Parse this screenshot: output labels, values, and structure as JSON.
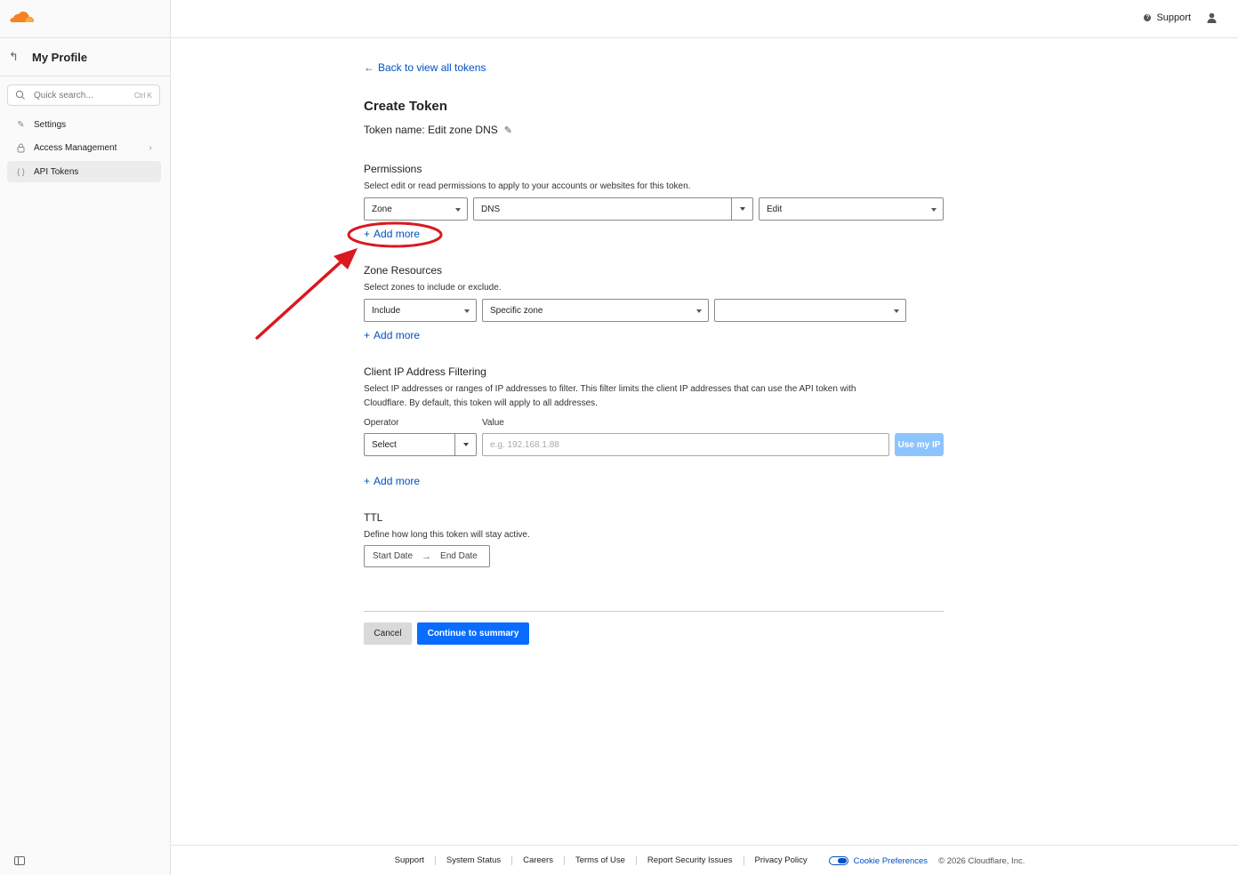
{
  "sidebar": {
    "profile_title": "My Profile",
    "search_placeholder": "Quick search...",
    "search_shortcut": "Ctrl K",
    "items": [
      {
        "label": "Settings",
        "icon": "pencil-icon"
      },
      {
        "label": "Access Management",
        "icon": "lock-icon"
      },
      {
        "label": "API Tokens",
        "icon": "braces-icon"
      }
    ]
  },
  "topbar": {
    "support_label": "Support"
  },
  "main": {
    "back_link": "Back to view all tokens",
    "title": "Create Token",
    "token_name": "Token name: Edit zone DNS",
    "permissions": {
      "heading": "Permissions",
      "description": "Select edit or read permissions to apply to your accounts or websites for this token.",
      "scope": "Zone",
      "resource": "DNS",
      "access": "Edit",
      "add_more": "Add more"
    },
    "zone_resources": {
      "heading": "Zone Resources",
      "description": "Select zones to include or exclude.",
      "include": "Include",
      "specific": "Specific zone",
      "zone": "",
      "add_more": "Add more"
    },
    "ip_filtering": {
      "heading": "Client IP Address Filtering",
      "description_line1": "Select IP addresses or ranges of IP addresses to filter. This filter limits the client IP addresses that can use the API token with",
      "description_line2": "Cloudflare. By default, this token will apply to all addresses.",
      "operator_label": "Operator",
      "value_label": "Value",
      "operator_value": "Select",
      "value_placeholder": "e.g. 192.168.1.88",
      "use_my_ip": "Use my IP",
      "add_more": "Add more"
    },
    "ttl": {
      "heading": "TTL",
      "description": "Define how long this token will stay active.",
      "start": "Start Date",
      "end": "End Date"
    },
    "actions": {
      "cancel": "Cancel",
      "continue": "Continue to summary"
    }
  },
  "footer": {
    "links": [
      "Support",
      "System Status",
      "Careers",
      "Terms of Use",
      "Report Security Issues",
      "Privacy Policy"
    ],
    "cookie_preferences": "Cookie Preferences",
    "copyright": "© 2026 Cloudflare, Inc."
  },
  "colors": {
    "brand_orange": "#f6821f",
    "link_blue": "#0051c3",
    "primary_button": "#0a6cff",
    "annotation_red": "#d9181f"
  }
}
